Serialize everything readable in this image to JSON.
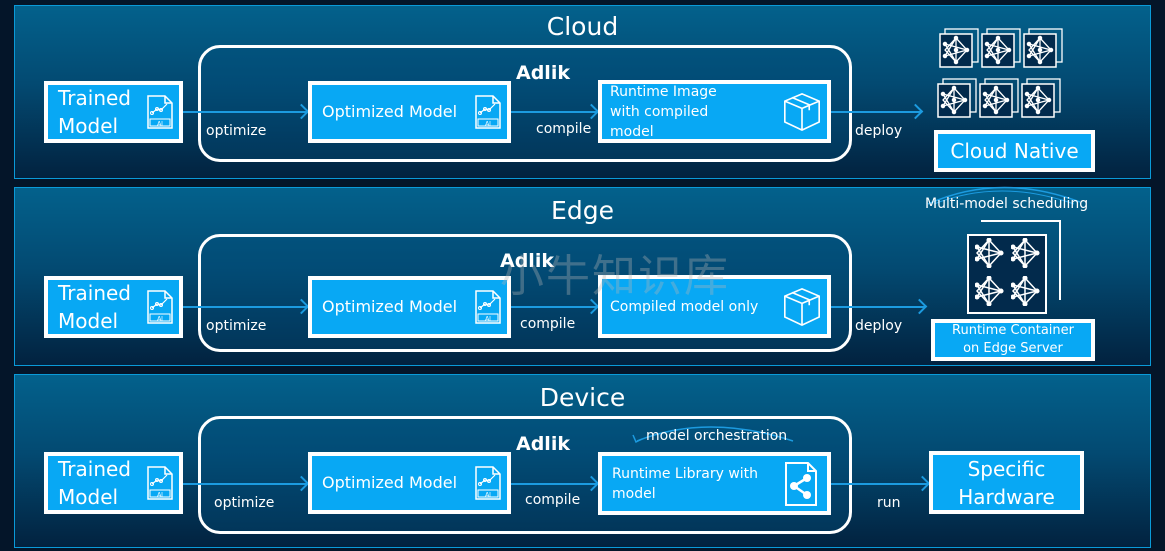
{
  "colors": {
    "panel_border": "#0a9ad8",
    "box_fill": "#08a8f4",
    "arrow": "#1c9be0",
    "background": "#041529"
  },
  "watermark": "小牛知识库",
  "cloud": {
    "title": "Cloud",
    "adlik": "Adlik",
    "trained": [
      "Trained",
      "Model"
    ],
    "optimized": "Optimized Model",
    "runtime": [
      "Runtime Image",
      "with compiled",
      "model"
    ],
    "target": "Cloud Native",
    "optimize": "optimize",
    "compile": "compile",
    "deploy": "deploy",
    "icons": [
      "ai-file-icon",
      "package-box-icon",
      "neural-network-container-icon"
    ]
  },
  "edge": {
    "title": "Edge",
    "adlik": "Adlik",
    "trained": [
      "Trained",
      "Model"
    ],
    "optimized": "Optimized Model",
    "runtime": "Compiled model only",
    "target": [
      "Runtime Container",
      "on Edge Server"
    ],
    "scheduling": "Multi-model scheduling",
    "optimize": "optimize",
    "compile": "compile",
    "deploy": "deploy"
  },
  "device": {
    "title": "Device",
    "adlik": "Adlik",
    "trained": [
      "Trained",
      "Model"
    ],
    "optimized": "Optimized Model",
    "runtime": [
      "Runtime Library with",
      "model"
    ],
    "target": [
      "Specific",
      "Hardware"
    ],
    "orchestration": "model orchestration",
    "optimize": "optimize",
    "compile": "compile",
    "run": "run",
    "icons": [
      "share-file-icon"
    ]
  }
}
